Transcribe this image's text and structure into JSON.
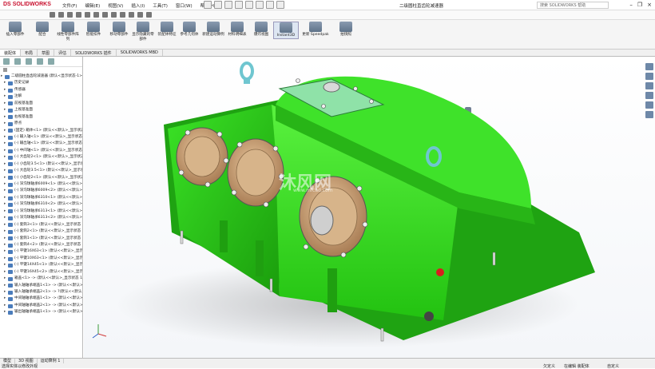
{
  "app": {
    "brand": "SOLIDWORKS",
    "brand_prefix": "DS",
    "doc_title": "二级圆柱直齿轮减速器"
  },
  "menu": [
    "文件(F)",
    "编辑(E)",
    "视图(V)",
    "插入(I)",
    "工具(T)",
    "窗口(W)",
    "帮助(H)"
  ],
  "search_placeholder": "搜索 SOLIDWORKS 帮助",
  "ribbon": [
    "插入零部件",
    "配合",
    "线性零部件阵列",
    "智能扣件",
    "移动零部件",
    "显示隐藏的零部件",
    "装配体特征",
    "参考几何体",
    "新建运动算例",
    "材料明细表",
    "爆炸视图",
    "Instant3D",
    "更新 Speedpak",
    "拍快照"
  ],
  "tabs": [
    "装配体",
    "布局",
    "草图",
    "评估",
    "SOLIDWORKS 插件",
    "SOLIDWORKS MBD"
  ],
  "tree": [
    {
      "label": "二级圆柱直齿轮减速器 (默认<显示状态-1>)",
      "top": true
    },
    {
      "label": "历史记录"
    },
    {
      "label": "传感器"
    },
    {
      "label": "注解"
    },
    {
      "label": "前视基准面"
    },
    {
      "label": "上视基准面"
    },
    {
      "label": "右视基准面"
    },
    {
      "label": "原点"
    },
    {
      "label": "(固定) 箱体<1> (默认<<默认>_显示状态 1>)"
    },
    {
      "label": "(-) 输入轴<1> (默认<<默认>_显示状态 1>)"
    },
    {
      "label": "(-) 输出轴<1> (默认<<默认>_显示状态 1>)"
    },
    {
      "label": "(-) 中间轴<1> (默认<<默认>_显示状态 1>)"
    },
    {
      "label": "(-) 大齿轮2<1> (默认<<默认>_显示状态 1>)"
    },
    {
      "label": "(-) 小齿轮3.5<1> (默认<<默认>_显示状态 1>)"
    },
    {
      "label": "(-) 大齿轮3.5<1> (默认<<默认>_显示状态 1>)"
    },
    {
      "label": "(-) 小齿轮2<1> (默认<<默认>_显示状态 1>)"
    },
    {
      "label": "(-) 深沟球轴承6009<1> (默认<<默认>_显示状态 1>)"
    },
    {
      "label": "(-) 深沟球轴承6009<2> (默认<<默认>_显示状态 1>)"
    },
    {
      "label": "(-) 深沟球轴承6310<1> (默认<<默认>_显示状态 1>)"
    },
    {
      "label": "(-) 深沟球轴承6310<2> (默认<<默认>_显示状态 1>)"
    },
    {
      "label": "(-) 深沟球轴承6313<1> (默认<<默认>_显示状态 1>)"
    },
    {
      "label": "(-) 深沟球轴承6313<2> (默认<<默认>_显示状态 1>)"
    },
    {
      "label": "(-) 套筒3<1> (默认<<默认>_显示状态 1>)"
    },
    {
      "label": "(-) 套筒2<1> (默认<<默认>_显示状态 1>)"
    },
    {
      "label": "(-) 套筒1<1> (默认<<默认>_显示状态 1>)"
    },
    {
      "label": "(-) 套筒4<2> (默认<<默认>_显示状态 1>)"
    },
    {
      "label": "(-) 平键16X63<1> (默认<<默认>_显示状态 1>)"
    },
    {
      "label": "(-) 平键10X63<1> (默认<<默认>_显示状态 1>)"
    },
    {
      "label": "(-) 平键14X45<1> (默认<<默认>_显示状态 1>)"
    },
    {
      "label": "(-) 平键16X45<2> (默认<<默认>_显示状态 1>)"
    },
    {
      "label": "箱盖<1> -> (默认<<默认>_显示状态 1>)"
    },
    {
      "label": "输入轴轴承端盖1<1> -> (默认<<默认>_显示状态 1>)"
    },
    {
      "label": "输入轴轴承端盖2<1> -> ?(默认<<默认>_显示状态 1>)"
    },
    {
      "label": "中间轴轴承端盖1<1> -> (默认<<默认>_显示状态 1>)"
    },
    {
      "label": "中间轴轴承端盖2<1> -> (默认<<默认>_显示状态 1>)"
    },
    {
      "label": "输出轴轴承端盖1<1> -> (默认<<默认>_显示状态 1>)"
    }
  ],
  "status": {
    "tabs": [
      "模型",
      "3D 视图",
      "运动算例 1"
    ],
    "left_text": "选择实体以修改外观",
    "right": [
      "欠定义",
      "在编辑 装配体",
      "自定义"
    ]
  },
  "watermark": {
    "main": "沐风网",
    "sub": "www.mfcad.com"
  },
  "colors": {
    "housing": "#33dd1f",
    "housing_shade": "#22a812",
    "bearing_cap": "#c8a47e",
    "hook": "#6fc6d0"
  }
}
